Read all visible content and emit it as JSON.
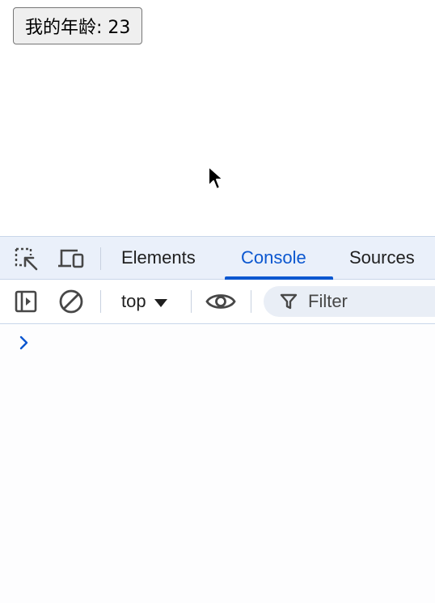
{
  "page": {
    "button_label": "我的年龄: 23"
  },
  "devtools": {
    "icons": {
      "inspect": "inspect-element-icon",
      "device": "device-toolbar-icon",
      "sidebar": "show-sidebar-icon",
      "clear": "clear-console-icon",
      "eye": "live-expression-eye-icon",
      "filter": "filter-funnel-icon",
      "prompt": "console-prompt-chevron-icon"
    },
    "tabs": [
      {
        "label": "Elements",
        "active": false
      },
      {
        "label": "Console",
        "active": true
      },
      {
        "label": "Sources",
        "active": false
      }
    ],
    "toolbar": {
      "context": "top",
      "filter_placeholder": "Filter"
    }
  },
  "colors": {
    "accent": "#0b57d0",
    "tabbar_bg": "#eaf0fa",
    "button_bg": "#efefef"
  }
}
